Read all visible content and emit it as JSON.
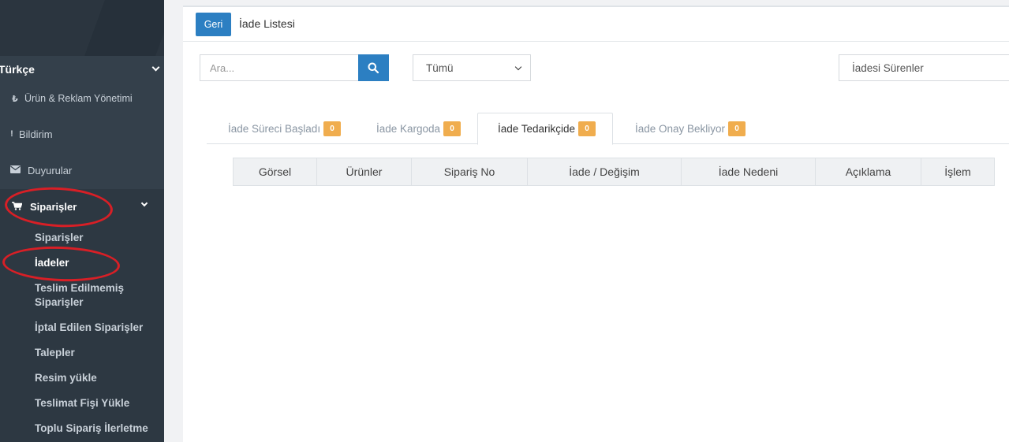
{
  "sidebar": {
    "language": "Türkçe",
    "menu": [
      {
        "icon": "lira-icon",
        "glyph": "₺",
        "label": "Ürün & Reklam Yönetimi"
      },
      {
        "icon": "exclamation-icon",
        "glyph": "!",
        "label": "Bildirim"
      },
      {
        "icon": "envelope-icon",
        "glyph": "✉",
        "label": "Duyurular"
      },
      {
        "icon": "cart-icon",
        "glyph": "🛒",
        "label": "Siparişler"
      }
    ],
    "submenu": [
      {
        "label": "Siparişler"
      },
      {
        "label": "İadeler"
      },
      {
        "label": "Teslim Edilmemiş Siparişler"
      },
      {
        "label": "İptal Edilen Siparişler"
      },
      {
        "label": "Talepler"
      },
      {
        "label": "Resim yükle"
      },
      {
        "label": "Teslimat Fişi Yükle"
      },
      {
        "label": "Toplu Sipariş İlerletme"
      }
    ]
  },
  "header": {
    "back_label": "Geri",
    "title": "İade Listesi"
  },
  "filters": {
    "search_placeholder": "Ara...",
    "status_select": "Tümü",
    "filter_value": "İadesi Sürenler"
  },
  "tabs": [
    {
      "label": "İade Süreci Başladı",
      "count": "0"
    },
    {
      "label": "İade Kargoda",
      "count": "0"
    },
    {
      "label": "İade Tedarikçide",
      "count": "0"
    },
    {
      "label": "İade Onay Bekliyor",
      "count": "0"
    }
  ],
  "table": {
    "columns": [
      "Görsel",
      "Ürünler",
      "Sipariş No",
      "İade / Değişim",
      "İade Nedeni",
      "Açıklama",
      "İşlem"
    ]
  },
  "colors": {
    "sidebar_bg": "#34404b",
    "primary": "#2c7fc2",
    "badge": "#f0ad4e",
    "annotation": "#d81f26"
  }
}
